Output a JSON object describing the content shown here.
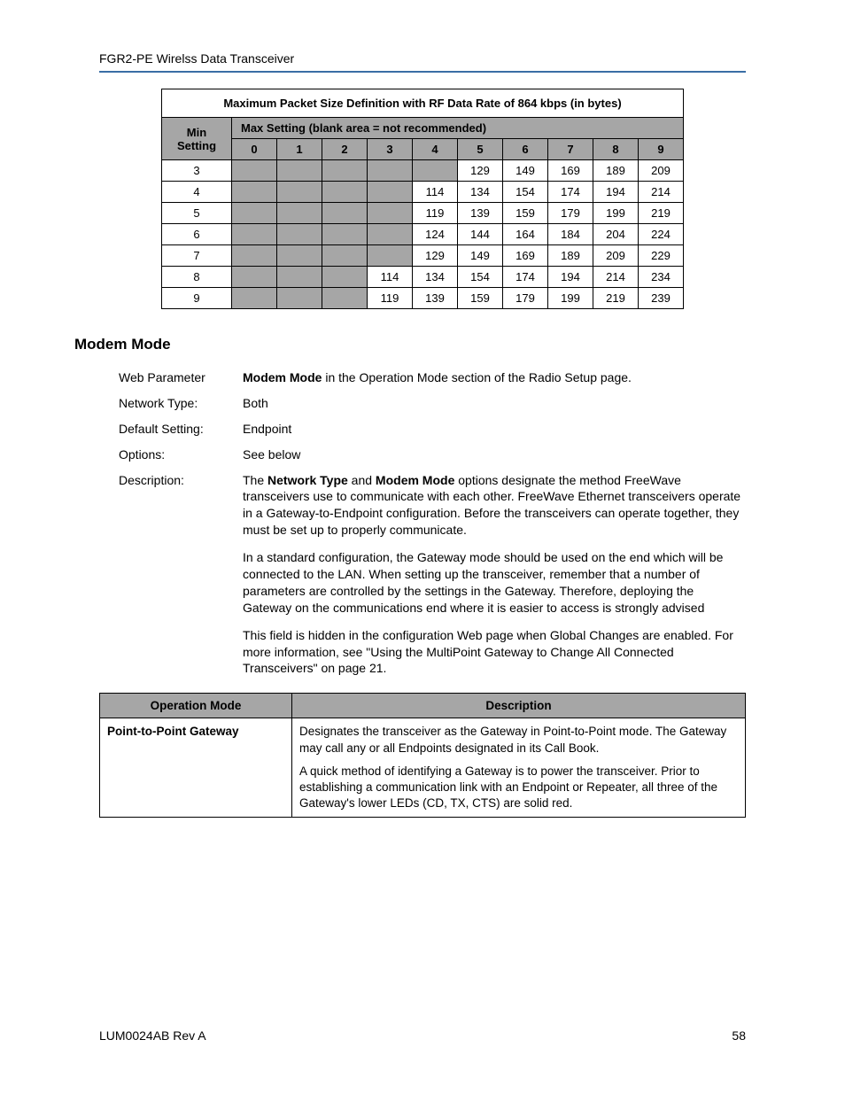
{
  "header": {
    "title": "FGR2-PE Wirelss Data Transceiver"
  },
  "packet_table": {
    "title": "Maximum Packet Size Definition with RF Data Rate of 864 kbps (in bytes)",
    "max_setting_label": "Max Setting (blank area = not recommended)",
    "min_setting_label": "Min Setting",
    "columns": [
      "0",
      "1",
      "2",
      "3",
      "4",
      "5",
      "6",
      "7",
      "8",
      "9"
    ],
    "rows": [
      {
        "min": "3",
        "cells": [
          "",
          "",
          "",
          "",
          "",
          "129",
          "149",
          "169",
          "189",
          "209"
        ]
      },
      {
        "min": "4",
        "cells": [
          "",
          "",
          "",
          "",
          "114",
          "134",
          "154",
          "174",
          "194",
          "214"
        ]
      },
      {
        "min": "5",
        "cells": [
          "",
          "",
          "",
          "",
          "119",
          "139",
          "159",
          "179",
          "199",
          "219"
        ]
      },
      {
        "min": "6",
        "cells": [
          "",
          "",
          "",
          "",
          "124",
          "144",
          "164",
          "184",
          "204",
          "224"
        ]
      },
      {
        "min": "7",
        "cells": [
          "",
          "",
          "",
          "",
          "129",
          "149",
          "169",
          "189",
          "209",
          "229"
        ]
      },
      {
        "min": "8",
        "cells": [
          "",
          "",
          "",
          "114",
          "134",
          "154",
          "174",
          "194",
          "214",
          "234"
        ]
      },
      {
        "min": "9",
        "cells": [
          "",
          "",
          "",
          "119",
          "139",
          "159",
          "179",
          "199",
          "219",
          "239"
        ]
      }
    ]
  },
  "section_heading": "Modem Mode",
  "defs": {
    "web_parameter": {
      "label": "Web Parameter",
      "bold": "Modem Mode",
      "rest": " in the Operation Mode section of the Radio Setup page."
    },
    "network_type": {
      "label": "Network Type:",
      "value": "Both"
    },
    "default_setting": {
      "label": "Default Setting:",
      "value": "Endpoint"
    },
    "options": {
      "label": "Options:",
      "value": "See below"
    },
    "description": {
      "label": "Description:",
      "p1_pre": "The ",
      "p1_b1": "Network Type",
      "p1_mid": " and ",
      "p1_b2": "Modem Mode",
      "p1_post": " options designate the method FreeWave transceivers use to communicate with each other. FreeWave Ethernet transceivers operate in a Gateway-to-Endpoint configuration. Before the transceivers can operate together, they must be set up to properly communicate.",
      "p2": "In a standard configuration, the Gateway mode should be used on the end which will be connected to the LAN. When setting up the transceiver, remember that a number of parameters are controlled by the settings in the Gateway. Therefore, deploying the Gateway on the communications end where it is easier to access is strongly advised",
      "p3": "This field is hidden in the configuration Web page when Global Changes are enabled. For more information, see \"Using the MultiPoint Gateway to Change All Connected Transceivers\" on page 21."
    }
  },
  "opmode_table": {
    "headers": {
      "mode": "Operation Mode",
      "desc": "Description"
    },
    "row": {
      "mode": "Point-to-Point Gateway",
      "p1": "Designates the transceiver as the Gateway in Point-to-Point mode. The Gateway may call any or all Endpoints designated in its Call Book.",
      "p2": "A quick method of identifying a Gateway is to power the transceiver. Prior to establishing a communication link with an Endpoint or Repeater, all three of the Gateway's lower LEDs (CD, TX, CTS) are solid red."
    }
  },
  "footer": {
    "left": "LUM0024AB Rev A",
    "right": "58"
  }
}
